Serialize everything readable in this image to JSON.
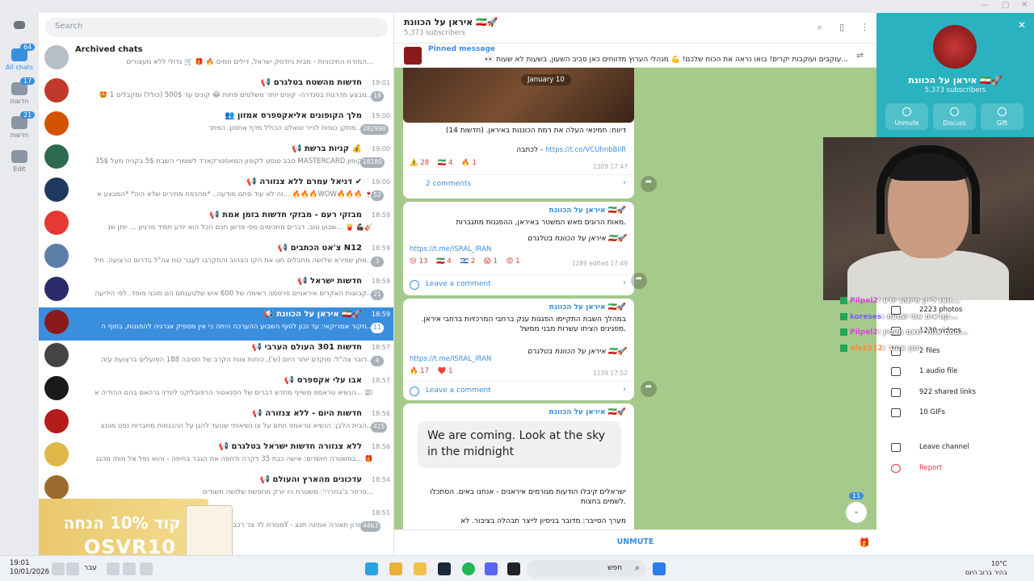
{
  "sidebar": {
    "items": [
      {
        "label": "All chats",
        "badge": "64"
      },
      {
        "label": "חדשות",
        "badge": "17"
      },
      {
        "label": "חדשות",
        "badge": "21"
      },
      {
        "label": "Edit",
        "badge": ""
      }
    ]
  },
  "chatlist": {
    "search_placeholder": "Search",
    "chats": [
      {
        "title": "Archived chats",
        "preview": "המזרח התיכוניות - מבית גיזדסק ישראל, דילים חמים 🔥 🎁 🛒 גדולי ללא מעצורים...",
        "time": "",
        "badge": "",
        "color": "#b8bec6"
      },
      {
        "title": "📢 חדשות מהשטח בטלגרם",
        "preview": "🤩 מבצע מדרגות בסנדרה- קונים יותר משלמים פחות 😂 קונים עד 500$ (כולל) ומקבלים 1...",
        "time": "19:01",
        "badge": "18",
        "color": "#c0392b"
      },
      {
        "title": "👥 מלך הקופונים אליאקספרס אמזון",
        "preview": "מתקן כוסות לנייר טואלט הכולל מדף אחסון. הפתר... 📸",
        "time": "19:00",
        "badge": "282990",
        "color": "#d35400"
      },
      {
        "title": "📢 קניות ברשת 💰",
        "preview": "סבב טוסט לקופון המאסטרקארד לשומרי השבת 5$ בקניה מעל 35$ MASTERCARD הקופון...",
        "time": "19:00",
        "badge": "18180",
        "color": "#2d6a4f"
      },
      {
        "title": "📢 דניאל עמרם ללא צנזורה ✔",
        "preview": "זה לא עוד סתם מודעה.. *מהכפת מחירים שלא היה* *המבצע א... 🔥🔥🔥WOW🔥🔥🔥 🍷",
        "time": "19:00",
        "badge": "52",
        "color": "#1f3a5f"
      },
      {
        "title": "📢 מבזקי רעם - מבזקי חדשות בזמן אמת",
        "preview": "שבוע טוב. דברים מחכימים מפי פרשן חכם הכל הוא יודע תמיד מרגיע ... יותן שנ... 🍟 💪🏿🎸",
        "time": "18:59",
        "badge": "",
        "color": "#e53935"
      },
      {
        "title": "📢 צ'אט הכתבים N12",
        "preview": "מתן שפירא שלושה מחבלים תגו את הקו הצהוב והתקרבו לעבר כוח צה\"ל בדרום הרצועה. חיל...",
        "time": "18:59",
        "badge": "3",
        "color": "#5b7fa8"
      },
      {
        "title": "📢 חדשות ישראל",
        "preview": "קבוצות האקרים איראניים פרסמה רשימה של 600 איש שלטענתם הם סוכני מוסד. לפי הידיעה...",
        "time": "18:59",
        "badge": "21",
        "color": "#2b2b6b"
      },
      {
        "title": "📢 איראן על הכוונת 🇮🇷🚀",
        "preview": "מקור אמריקאי: עד נכון לסוף השבוע ההערכה היתה כי אין מספיק אנרגיה להפגנות, בסוף ה...",
        "time": "18:59",
        "badge": "11",
        "color": "#8b1a1a"
      },
      {
        "title": "📢 חדשות 301 העולם הערבי",
        "preview": "דובר צה\"ל: מוקדם יותר היום (ש'), כוחות צוות הקרב של חטיבה 188 הפועלים ברצועת עזה...",
        "time": "18:57",
        "badge": "4",
        "color": "#444444"
      },
      {
        "title": "📢 אבו עלי אקספרס",
        "preview": "הנשיא טראמפ משייף מחדש דברים של הסנאטור הרפובליקני לינדזי גרהאם בהם ההודיה א... 📰",
        "time": "18:57",
        "badge": "",
        "color": "#1a1a1a"
      },
      {
        "title": "📢 חדשות היום - ללא צנזורה",
        "preview": "הבית הלבן: הנשיא טראמפ חתם על צו נשיאותי שנועד להגן על ההכנסות מחברות נפט מוונצ...",
        "time": "18:56",
        "badge": "415",
        "color": "#b71c1c"
      },
      {
        "title": "📢 ללא צנזורה חדשות ישראל בטלגרם",
        "preview": "במשטרה חושדים: אישה כבת 35 דקרה ודחפה את הגבר בחיפה - והוא נפל אל מותו מהגג... 🎁",
        "time": "18:56",
        "badge": "",
        "color": "#e0b84a"
      },
      {
        "title": "📢 עדכונים מהארץ והעולם",
        "preview": "פרסר ב'בחררי': משטרת ניו יורק מחפשת שלושה חשודים...",
        "time": "18:54",
        "badge": "",
        "color": "#9a6b2a"
      },
      {
        "title": "",
        "preview": "מנורת לד צד רכב 75Y - פתרון תאורה אמינה תנצ...",
        "time": "18:51",
        "badge": "4463",
        "color": "#777777"
      }
    ]
  },
  "promo": {
    "line1": "קוד 10% הנחה",
    "line2": "OSVR10"
  },
  "channel": {
    "title": "איראן על הכוונת 🇮🇷🚀",
    "subscribers": "5,373 subscribers",
    "pinned_label": "Pinned message",
    "pinned_text": "👀 עוקבים ועוקבות יקרים! בואו נראה את הכוח שלכם! 💪 מנהלי הערוץ מדווחים כאן סביב השעון, בשעות לא שעות...",
    "date_pill": "January 10",
    "messages": [
      {
        "author": "",
        "text": "דיווח: חמינאי העלה את רמת הכוננות באיראן. (חדשות 14)",
        "link_label": "לכתבה -",
        "link": "https://t.co/VCUhnbBilR",
        "reactions": [
          "⚠️ 28",
          "🇮🇷 4",
          "🔥 1"
        ],
        "views": "1309",
        "time": "17:47",
        "comments": "2 comments"
      },
      {
        "author": "איראן על הכוונת 🇮🇷🚀",
        "text": "מאות הרוגים מאש המשטר באיראן, ההפגנות מתגברות.",
        "signature": "איראן על הכוונת בטלגרם 🇮🇷🚀",
        "link": "https://t.me/ISRAL_IRAN",
        "reactions": [
          "😢 13",
          "🇮🇷 4",
          "🇮🇱 2",
          "😱 1",
          "😡 1"
        ],
        "views": "1289",
        "time": "edited 17:49",
        "comments": "Leave a comment"
      },
      {
        "author": "איראן על הכוונת 🇮🇷🚀",
        "text": "במהלך השבת התקיימו הפגנות ענק ברחבי המרכזיות ברחבי איראן. מפגינים הציתו עשרות מבני ממשל.",
        "signature": "איראן על הכוונת בטלגרם 🇮🇷🚀",
        "link": "https://t.me/ISRAL_IRAN",
        "reactions": [
          "🔥 17",
          "❤️ 1"
        ],
        "views": "1239",
        "time": "17:52",
        "comments": "Leave a comment"
      },
      {
        "author": "איראן על הכוונת 🇮🇷🚀",
        "quote": "We are coming. Look at the sky in the midnight",
        "text": "ישראלים קיבלו הודעות מגורמים איראנים - אנחנו באים. הסתכלו לשמים בחצות.",
        "text2": "מערך הסייבר: מדובר בניסיון לייצר תבהלה בציבור. לא"
      }
    ],
    "unmute_label": "UNMUTE",
    "scroll_badge": "11"
  },
  "info_panel": {
    "name": "איראן על הכוונת 🇮🇷🚀",
    "subscribers": "5,373 subscribers",
    "actions": [
      "Unmute",
      "Discuss",
      "Gift"
    ],
    "stats": [
      "2223 photos",
      "1230 videos",
      "2 files",
      "1 audio file",
      "922 shared links",
      "10 GIFs"
    ],
    "leave": "Leave channel",
    "report": "Report"
  },
  "stream_chat": [
    {
      "user": "Pilpel2",
      "text": ": וואו לייק מישהו יודע...",
      "color": "#e040e0"
    },
    {
      "user": "koreses",
      "text": ": קוראים אחי שמעת...",
      "color": "#7a5cff"
    },
    {
      "user": "Pilpel2",
      "text": ": סתם אומר שאם מעניין...",
      "color": "#e040e0"
    },
    {
      "user": "afek112",
      "text": ": יומן אומר",
      "color": "#ff8a3d"
    }
  ],
  "taskbar": {
    "time": "19:01",
    "date": "10/01/2026",
    "lang": "עבר",
    "search": "חפש",
    "weather_temp": "10°C",
    "weather_desc": "בהיר ברוב היום"
  }
}
